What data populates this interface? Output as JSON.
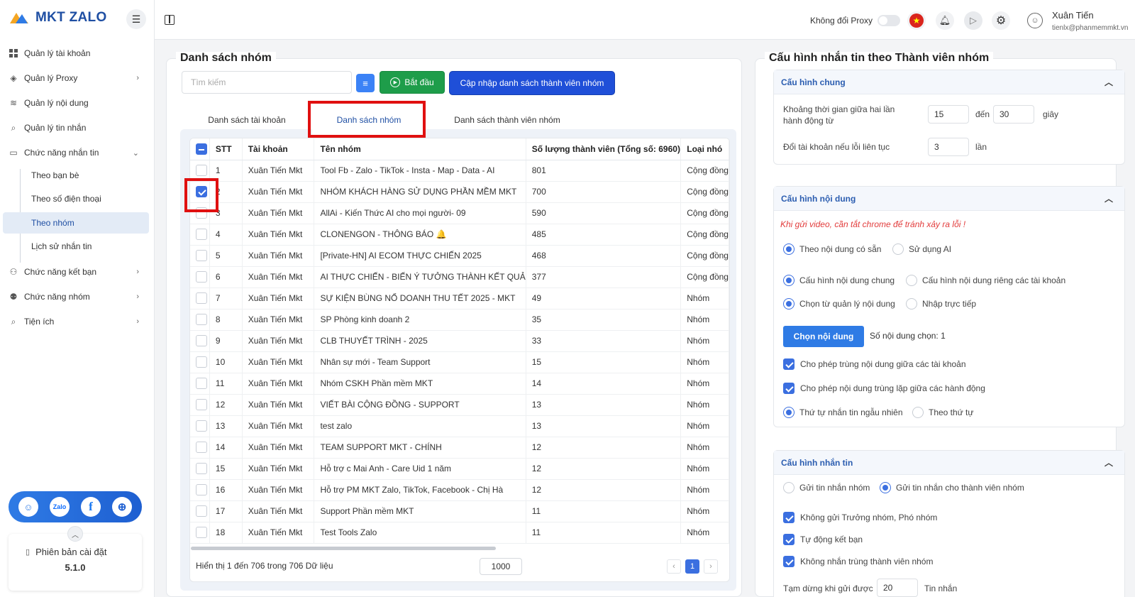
{
  "app": {
    "logo_text": "MKT ZALO"
  },
  "sidebar": {
    "items": [
      {
        "label": "Quản lý tài khoản"
      },
      {
        "label": "Quản lý Proxy"
      },
      {
        "label": "Quản lý nội dung"
      },
      {
        "label": "Quản lý tin nhắn"
      },
      {
        "label": "Chức năng nhắn tin"
      },
      {
        "label": "Chức năng kết bạn"
      },
      {
        "label": "Chức năng nhóm"
      },
      {
        "label": "Tiện ích"
      }
    ],
    "subitems": [
      {
        "label": "Theo bạn bè"
      },
      {
        "label": "Theo số điện thoại"
      },
      {
        "label": "Theo nhóm"
      },
      {
        "label": "Lịch sử nhắn tin"
      }
    ],
    "version_label": "Phiên bản cài đặt",
    "version": "5.1.0"
  },
  "topbar": {
    "proxy_label": "Không đổi Proxy",
    "user_name": "Xuân Tiến",
    "user_email": "tienlx@phanmemmkt.vn"
  },
  "main": {
    "title": "Danh sách nhóm",
    "search_placeholder": "Tìm kiếm",
    "start_label": "Bắt đầu",
    "update_label": "Cập nhập danh sách thành viên nhóm",
    "tabs": [
      {
        "label": "Danh sách tài khoản"
      },
      {
        "label": "Danh sách nhóm"
      },
      {
        "label": "Danh sách thành viên nhóm"
      }
    ],
    "table": {
      "headers": [
        "STT",
        "Tài khoản",
        "Tên nhóm",
        "Số lượng thành viên (Tổng số: 6960)",
        "Loại nhó"
      ],
      "rows": [
        [
          "1",
          "Xuân Tiến Mkt",
          "Tool Fb - Zalo - TikTok - Insta - Map - Data - AI",
          "801",
          "Cộng đồng",
          false
        ],
        [
          "2",
          "Xuân Tiến Mkt",
          "NHÓM KHÁCH HÀNG SỬ DỤNG PHẦN MỀM MKT",
          "700",
          "Cộng đồng",
          true
        ],
        [
          "3",
          "Xuân Tiến Mkt",
          "AllAi - Kiến Thức AI cho mọi người- 09",
          "590",
          "Cộng đồng",
          false
        ],
        [
          "4",
          "Xuân Tiến Mkt",
          "CLONENGON - THÔNG BÁO 🔔",
          "485",
          "Cộng đồng",
          false
        ],
        [
          "5",
          "Xuân Tiến Mkt",
          "[Private-HN] AI ECOM THỰC CHIẾN 2025",
          "468",
          "Cộng đồng",
          false
        ],
        [
          "6",
          "Xuân Tiến Mkt",
          "AI THỰC CHIẾN - BIẾN Ý TƯỞNG THÀNH KẾT QUẢ",
          "377",
          "Cộng đồng",
          false
        ],
        [
          "7",
          "Xuân Tiến Mkt",
          "SỰ KIỆN BÙNG NỔ DOANH THU TẾT 2025 - MKT",
          "49",
          "Nhóm",
          false
        ],
        [
          "8",
          "Xuân Tiến Mkt",
          "SP Phòng kinh doanh 2",
          "35",
          "Nhóm",
          false
        ],
        [
          "9",
          "Xuân Tiến Mkt",
          "CLB THUYẾT TRÌNH - 2025",
          "33",
          "Nhóm",
          false
        ],
        [
          "10",
          "Xuân Tiến Mkt",
          "Nhân sự mới - Team Support",
          "15",
          "Nhóm",
          false
        ],
        [
          "11",
          "Xuân Tiến Mkt",
          "Nhóm CSKH Phần mềm MKT",
          "14",
          "Nhóm",
          false
        ],
        [
          "12",
          "Xuân Tiến Mkt",
          "VIẾT BÀI CỘNG ĐỒNG - SUPPORT",
          "13",
          "Nhóm",
          false
        ],
        [
          "13",
          "Xuân Tiến Mkt",
          "test zalo",
          "13",
          "Nhóm",
          false
        ],
        [
          "14",
          "Xuân Tiến Mkt",
          "TEAM SUPPORT MKT - CHÍNH",
          "12",
          "Nhóm",
          false
        ],
        [
          "15",
          "Xuân Tiến Mkt",
          "Hỗ trợ c Mai Anh - Care Uid 1 năm",
          "12",
          "Nhóm",
          false
        ],
        [
          "16",
          "Xuân Tiến Mkt",
          "Hỗ trợ PM MKT Zalo, TikTok, Facebook - Chị Hà",
          "12",
          "Nhóm",
          false
        ],
        [
          "17",
          "Xuân Tiến Mkt",
          "Support Phần mềm MKT",
          "11",
          "Nhóm",
          false
        ],
        [
          "18",
          "Xuân Tiến Mkt",
          "Test Tools Zalo",
          "11",
          "Nhóm",
          false
        ]
      ]
    },
    "footer_text": "Hiển thị 1 đến 706 trong 706 Dữ liệu",
    "page_size": "1000",
    "current_page": "1"
  },
  "right": {
    "title": "Cấu hình nhắn tin theo Thành viên nhóm",
    "general": {
      "title": "Cấu hình chung",
      "interval_label": "Khoảng thời gian giữa hai lần hành động từ",
      "from": "15",
      "to_label": "đến",
      "to": "30",
      "unit": "giây",
      "switch_label": "Đổi tài khoản nếu lỗi liên tục",
      "switch_value": "3",
      "switch_unit": "lần"
    },
    "content": {
      "title": "Cấu hình nội dung",
      "warning": "Khi gửi video, cần tắt chrome để tránh xảy ra lỗi !",
      "r1a": "Theo nội dung có sẵn",
      "r1b": "Sử dụng AI",
      "r2a": "Cấu hình nội dung chung",
      "r2b": "Cấu hình nội dung riêng các tài khoản",
      "r3a": "Chọn từ quản lý nội dung",
      "r3b": "Nhập trực tiếp",
      "choose_btn": "Chọn nội dung",
      "chosen_count": "Số nội dung chọn: 1",
      "c1": "Cho phép trùng nội dung giữa các tài khoản",
      "c2": "Cho phép nội dung trùng lặp giữa các hành động",
      "r4a": "Thứ tự nhắn tin ngẫu nhiên",
      "r4b": "Theo thứ tự"
    },
    "message": {
      "title": "Cấu hình nhắn tin",
      "r1a": "Gửi tin nhắn nhóm",
      "r1b": "Gửi tin nhắn cho thành viên nhóm",
      "c1": "Không gửi Trưởng nhóm, Phó nhóm",
      "c2": "Tự động kết bạn",
      "c3": "Không nhắn trùng thành viên nhóm",
      "pause_label": "Tạm dừng khi gửi được",
      "pause_value": "20",
      "pause_unit": "Tin nhắn"
    }
  }
}
